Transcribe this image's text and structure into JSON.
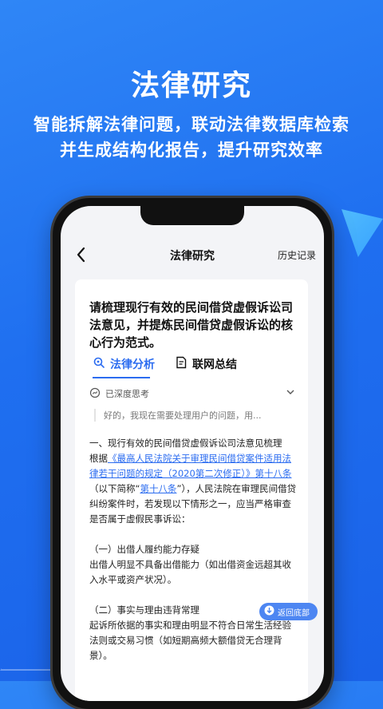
{
  "promo": {
    "title": "法律研究",
    "subtitle_line1": "智能拆解法律问题，联动法律数据库检索",
    "subtitle_line2": "并生成结构化报告，提升研究效率"
  },
  "appbar": {
    "title": "法律研究",
    "history": "历史记录"
  },
  "question": "请梳理现行有效的民间借贷虚假诉讼司法意见，并提炼民间借贷虚假诉讼的核心行为范式。",
  "tabs": [
    {
      "label": "法律分析"
    },
    {
      "label": "联网总结"
    }
  ],
  "thinking": {
    "label": "已深度思考",
    "preview": "好的，我现在需要处理用户的问题，用..."
  },
  "content": {
    "section1": "一、现行有效的民间借贷虚假诉讼司法意见梳理",
    "para_prefix": "根据",
    "law_link": "《最高人民法院关于审理民间借贷案件适用法律若干问题的规定（2020第二次修正）》第十八条",
    "para_mid1": "（以下简称“",
    "short_link": "第十八条",
    "para_rest": "”），人民法院在审理民间借贷纠纷案件时，若发现以下情形之一，应当严格审查是否属于虚假民事诉讼：",
    "item1_title": "（一）出借人履约能力存疑",
    "item1_text": "出借人明显不具备出借能力（如出借资金远超其收入水平或资产状况）。",
    "item2_title": "（二）事实与理由违背常理",
    "item2_text": "起诉所依据的事实和理由明显不符合日常生活经验法则或交易习惯（如短期高频大额借贷无合理背景）。"
  },
  "float_button": "返回底部"
}
